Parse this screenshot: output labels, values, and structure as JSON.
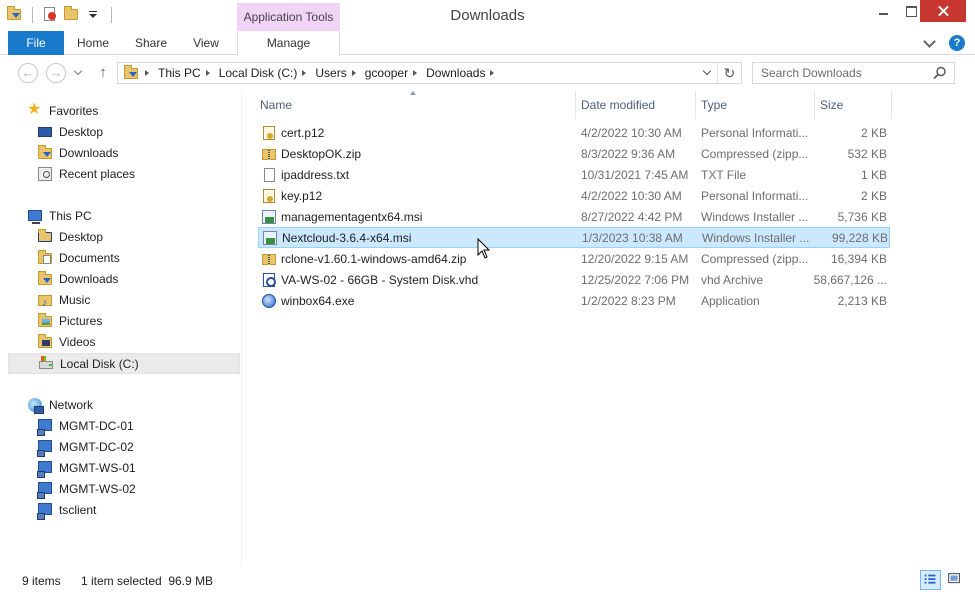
{
  "window": {
    "title": "Downloads",
    "context_tab_group": "Application Tools"
  },
  "ribbon": {
    "tabs": [
      "File",
      "Home",
      "Share",
      "View",
      "Manage"
    ]
  },
  "address": {
    "crumbs": [
      "This PC",
      "Local Disk (C:)",
      "Users",
      "gcooper",
      "Downloads"
    ]
  },
  "search": {
    "placeholder": "Search Downloads"
  },
  "nav": {
    "favorites": {
      "label": "Favorites",
      "items": [
        "Desktop",
        "Downloads",
        "Recent places"
      ]
    },
    "this_pc": {
      "label": "This PC",
      "items": [
        "Desktop",
        "Documents",
        "Downloads",
        "Music",
        "Pictures",
        "Videos",
        "Local Disk (C:)"
      ]
    },
    "network": {
      "label": "Network",
      "items": [
        "MGMT-DC-01",
        "MGMT-DC-02",
        "MGMT-WS-01",
        "MGMT-WS-02",
        "tsclient"
      ]
    }
  },
  "columns": {
    "name": "Name",
    "date": "Date modified",
    "type": "Type",
    "size": "Size"
  },
  "files": [
    {
      "name": "cert.p12",
      "date": "4/2/2022 10:30 AM",
      "type": "Personal Informati...",
      "size": "2 KB",
      "icon": "certificate-icon"
    },
    {
      "name": "DesktopOK.zip",
      "date": "8/3/2022 9:36 AM",
      "type": "Compressed (zipp...",
      "size": "532 KB",
      "icon": "zip-folder-icon"
    },
    {
      "name": "ipaddress.txt",
      "date": "10/31/2021 7:45 AM",
      "type": "TXT File",
      "size": "1 KB",
      "icon": "text-file-icon"
    },
    {
      "name": "key.p12",
      "date": "4/2/2022 10:30 AM",
      "type": "Personal Informati...",
      "size": "2 KB",
      "icon": "certificate-icon"
    },
    {
      "name": "managementagentx64.msi",
      "date": "8/27/2022 4:42 PM",
      "type": "Windows Installer ...",
      "size": "5,736 KB",
      "icon": "msi-installer-icon"
    },
    {
      "name": "Nextcloud-3.6.4-x64.msi",
      "date": "1/3/2023 10:38 AM",
      "type": "Windows Installer ...",
      "size": "99,228 KB",
      "icon": "msi-installer-icon"
    },
    {
      "name": "rclone-v1.60.1-windows-amd64.zip",
      "date": "12/20/2022 9:15 AM",
      "type": "Compressed (zipp...",
      "size": "16,394 KB",
      "icon": "zip-folder-icon"
    },
    {
      "name": "VA-WS-02 - 66GB - System Disk.vhd",
      "date": "12/25/2022 7:06 PM",
      "type": "vhd Archive",
      "size": "58,667,126 ...",
      "icon": "vhd-disk-icon"
    },
    {
      "name": "winbox64.exe",
      "date": "1/2/2022 8:23 PM",
      "type": "Application",
      "size": "2,213 KB",
      "icon": "application-icon"
    }
  ],
  "status": {
    "count": "9 items",
    "selection": "1 item selected  96.9 MB"
  },
  "colors": {
    "accent": "#1979ca",
    "context_tab": "#f1d4f7",
    "selection": "#cce8ff",
    "close": "#c7372f"
  }
}
